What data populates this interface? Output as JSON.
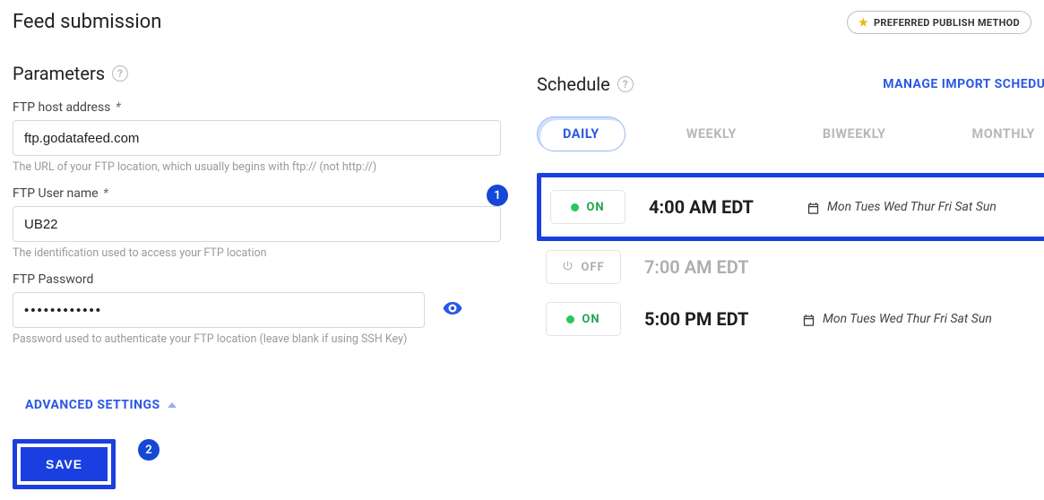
{
  "header": {
    "title": "Feed submission",
    "badge": "PREFERRED PUBLISH METHOD"
  },
  "parameters": {
    "title": "Parameters",
    "ftp_host": {
      "label": "FTP host address",
      "required_mark": "*",
      "value": "ftp.godatafeed.com",
      "hint": "The URL of your FTP location, which usually begins with ftp:// (not http://)"
    },
    "ftp_user": {
      "label": "FTP User name",
      "required_mark": "*",
      "value": "UB22",
      "hint": "The identification used to access your FTP location"
    },
    "ftp_pass": {
      "label": "FTP Password",
      "value": "••••••••••••",
      "hint": "Password used to authenticate your FTP location (leave blank if using SSH Key)"
    },
    "advanced": "ADVANCED SETTINGS",
    "save": "SAVE"
  },
  "markers": {
    "one": "1",
    "two": "2"
  },
  "schedule": {
    "title": "Schedule",
    "manage": "MANAGE IMPORT SCHEDULE",
    "tabs": {
      "daily": "DAILY",
      "weekly": "WEEKLY",
      "biweekly": "BIWEEKLY",
      "monthly": "MONTHLY"
    },
    "slots": [
      {
        "state": "ON",
        "time": "4:00 AM EDT",
        "days": "Mon Tues Wed Thur Fri Sat Sun",
        "highlight": true
      },
      {
        "state": "OFF",
        "time": "7:00 AM EDT",
        "days": ""
      },
      {
        "state": "ON",
        "time": "5:00 PM EDT",
        "days": "Mon Tues Wed Thur Fri Sat Sun"
      }
    ]
  }
}
